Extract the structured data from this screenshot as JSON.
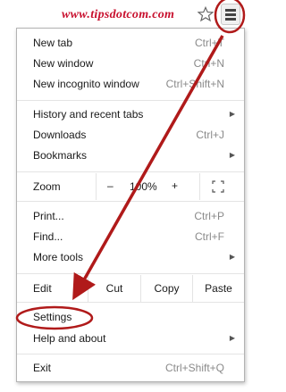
{
  "watermark": "www.tipsdotcom.com",
  "toolbar": {
    "star_icon": "star-icon",
    "menu_icon": "hamburger-icon"
  },
  "menu": {
    "new_tab": {
      "label": "New tab",
      "shortcut": "Ctrl+T"
    },
    "new_window": {
      "label": "New window",
      "shortcut": "Ctrl+N"
    },
    "new_incognito": {
      "label": "New incognito window",
      "shortcut": "Ctrl+Shift+N"
    },
    "history": {
      "label": "History and recent tabs"
    },
    "downloads": {
      "label": "Downloads",
      "shortcut": "Ctrl+J"
    },
    "bookmarks": {
      "label": "Bookmarks"
    },
    "zoom": {
      "label": "Zoom",
      "minus": "–",
      "value": "100%",
      "plus": "+"
    },
    "print": {
      "label": "Print...",
      "shortcut": "Ctrl+P"
    },
    "find": {
      "label": "Find...",
      "shortcut": "Ctrl+F"
    },
    "more_tools": {
      "label": "More tools"
    },
    "edit": {
      "label": "Edit",
      "cut": "Cut",
      "copy": "Copy",
      "paste": "Paste"
    },
    "settings": {
      "label": "Settings"
    },
    "help": {
      "label": "Help and about"
    },
    "exit": {
      "label": "Exit",
      "shortcut": "Ctrl+Shift+Q"
    }
  },
  "colors": {
    "annotation": "#b01a1a",
    "watermark": "#c8102e"
  }
}
